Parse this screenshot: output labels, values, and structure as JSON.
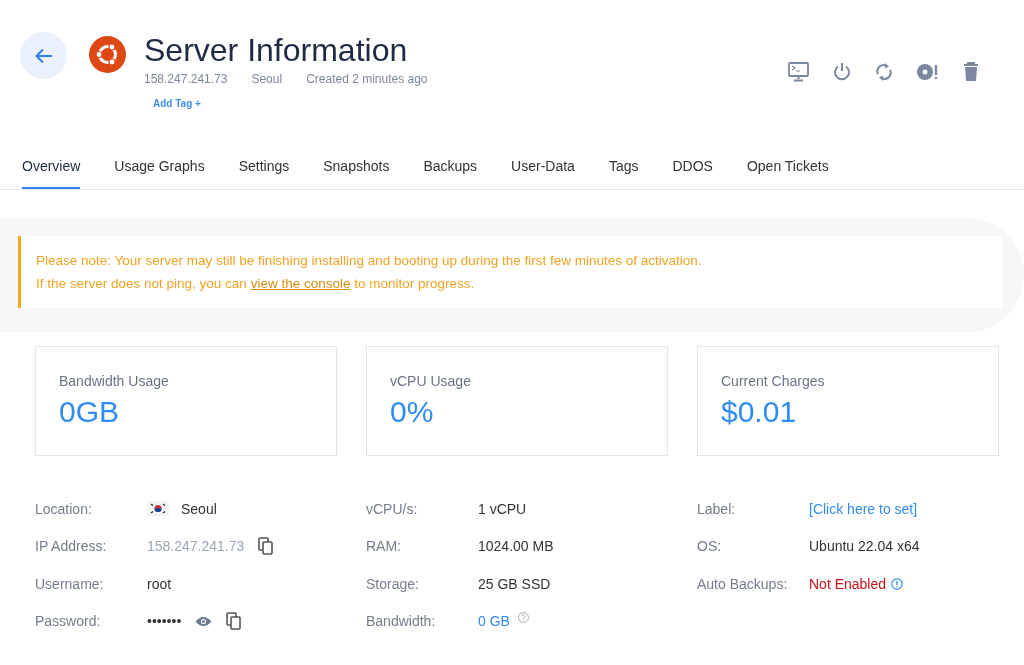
{
  "header": {
    "title": "Server Information",
    "ip": "158.247.241.73",
    "location": "Seoul",
    "created": "Created 2 minutes ago",
    "add_tag": "Add Tag +"
  },
  "tabs": [
    {
      "label": "Overview",
      "selected": true
    },
    {
      "label": "Usage Graphs",
      "selected": false
    },
    {
      "label": "Settings",
      "selected": false
    },
    {
      "label": "Snapshots",
      "selected": false
    },
    {
      "label": "Backups",
      "selected": false
    },
    {
      "label": "User-Data",
      "selected": false
    },
    {
      "label": "Tags",
      "selected": false
    },
    {
      "label": "DDOS",
      "selected": false
    },
    {
      "label": "Open Tickets",
      "selected": false
    }
  ],
  "notice": {
    "line_1": "Please note: Your server may still be finishing installing and booting up during the first few minutes of activation.",
    "line_2_before": "If the server does not ping, you can ",
    "line_2_link": "view the console",
    "line_2_after": " to monitor progress."
  },
  "stats": [
    {
      "label": "Bandwidth Usage",
      "value": "0GB"
    },
    {
      "label": "vCPU Usage",
      "value": "0%"
    },
    {
      "label": "Current Charges",
      "value": "$0.01"
    }
  ],
  "details": [
    [
      {
        "kind": "flag",
        "label": "Location:",
        "value": "Seoul"
      },
      {
        "kind": "copy",
        "label": "IP Address:",
        "value": "158.247.241.73"
      },
      {
        "kind": "text",
        "label": "Username:",
        "value": "root"
      },
      {
        "kind": "password",
        "label": "Password:",
        "value": "•••••••"
      }
    ],
    [
      {
        "kind": "text",
        "label": "vCPU/s:",
        "value": "1 vCPU"
      },
      {
        "kind": "text",
        "label": "RAM:",
        "value": "1024.00 MB"
      },
      {
        "kind": "text",
        "label": "Storage:",
        "value": "25 GB SSD"
      },
      {
        "kind": "help",
        "label": "Bandwidth:",
        "value": "0 GB"
      }
    ],
    [
      {
        "kind": "link",
        "label": "Label:",
        "value": "[Click here to set]"
      },
      {
        "kind": "text",
        "label": "OS:",
        "value": "Ubuntu 22.04 x64"
      },
      {
        "kind": "warning",
        "label": "Auto Backups:",
        "value": "Not Enabled"
      }
    ]
  ]
}
